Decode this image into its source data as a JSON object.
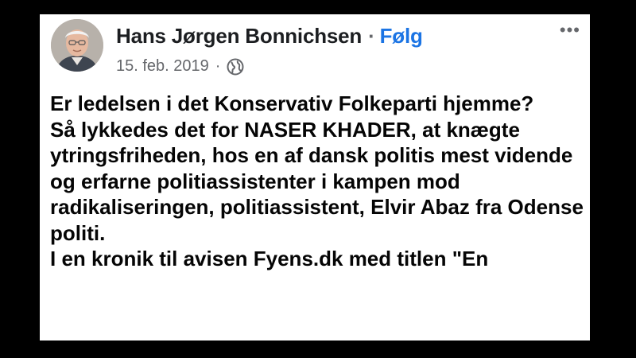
{
  "post": {
    "author_name": "Hans Jørgen Bonnichsen",
    "separator": "·",
    "follow_label": "Følg",
    "date": "15. feb. 2019",
    "meta_separator": "·",
    "privacy_icon": "globe-icon",
    "more_icon": "more-options-icon",
    "more_label": "•••",
    "paragraphs": [
      "Er ledelsen i det Konservativ Folkeparti hjemme?",
      "Så lykkedes det for NASER KHADER, at knægte ytringsfriheden, hos en af dansk politis mest vidende og erfarne politiassistenter i kampen mod radikaliseringen, politiassistent, Elvir Abaz fra Odense politi."
    ],
    "cut_off_line": "I en kronik til avisen Fyens.dk med titlen \"En"
  },
  "colors": {
    "background": "#000000",
    "card": "#ffffff",
    "text": "#050505",
    "secondary": "#65676b",
    "accent": "#1b74e4"
  }
}
